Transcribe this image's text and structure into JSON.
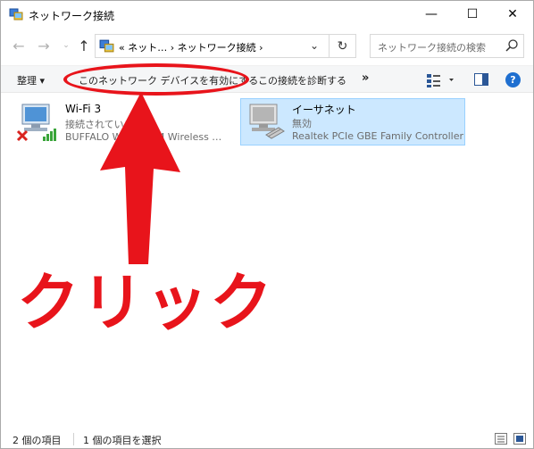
{
  "window": {
    "title": "ネットワーク接続",
    "minimize_glyph": "—",
    "maximize_glyph": "☐",
    "close_glyph": "✕"
  },
  "nav": {
    "back_glyph": "←",
    "forward_glyph": "→",
    "recent_glyph": "⌄",
    "up_glyph": "↑",
    "address_path": "« ネット… › ネットワーク接続 ›",
    "address_dropdown_glyph": "⌄",
    "refresh_glyph": "↻",
    "search_placeholder": "ネットワーク接続の検索"
  },
  "commands": {
    "organize": "整理 ▾",
    "enable_device": "このネットワーク デバイスを有効にする",
    "diagnose": "この接続を診断する",
    "more": "»",
    "help": "?"
  },
  "items": [
    {
      "name": "Wi-Fi 3",
      "status": "接続されていませ",
      "device": "BUFFALO WL…-GNM Wireless …",
      "icon": "wireless-adapter-disconnected-icon"
    },
    {
      "name": "イーサネット",
      "status": "無効",
      "device": "Realtek PCIe GBE Family Controller",
      "icon": "ethernet-adapter-disabled-icon",
      "selected": true
    }
  ],
  "annotation": {
    "text": "クリック",
    "color": "#e8141b"
  },
  "statusbar": {
    "count": "2 個の項目",
    "selected": "1 個の項目を選択"
  },
  "colors": {
    "selection_bg": "#cce8ff",
    "selection_border": "#99d1ff",
    "help_blue": "#1f6fd0"
  }
}
